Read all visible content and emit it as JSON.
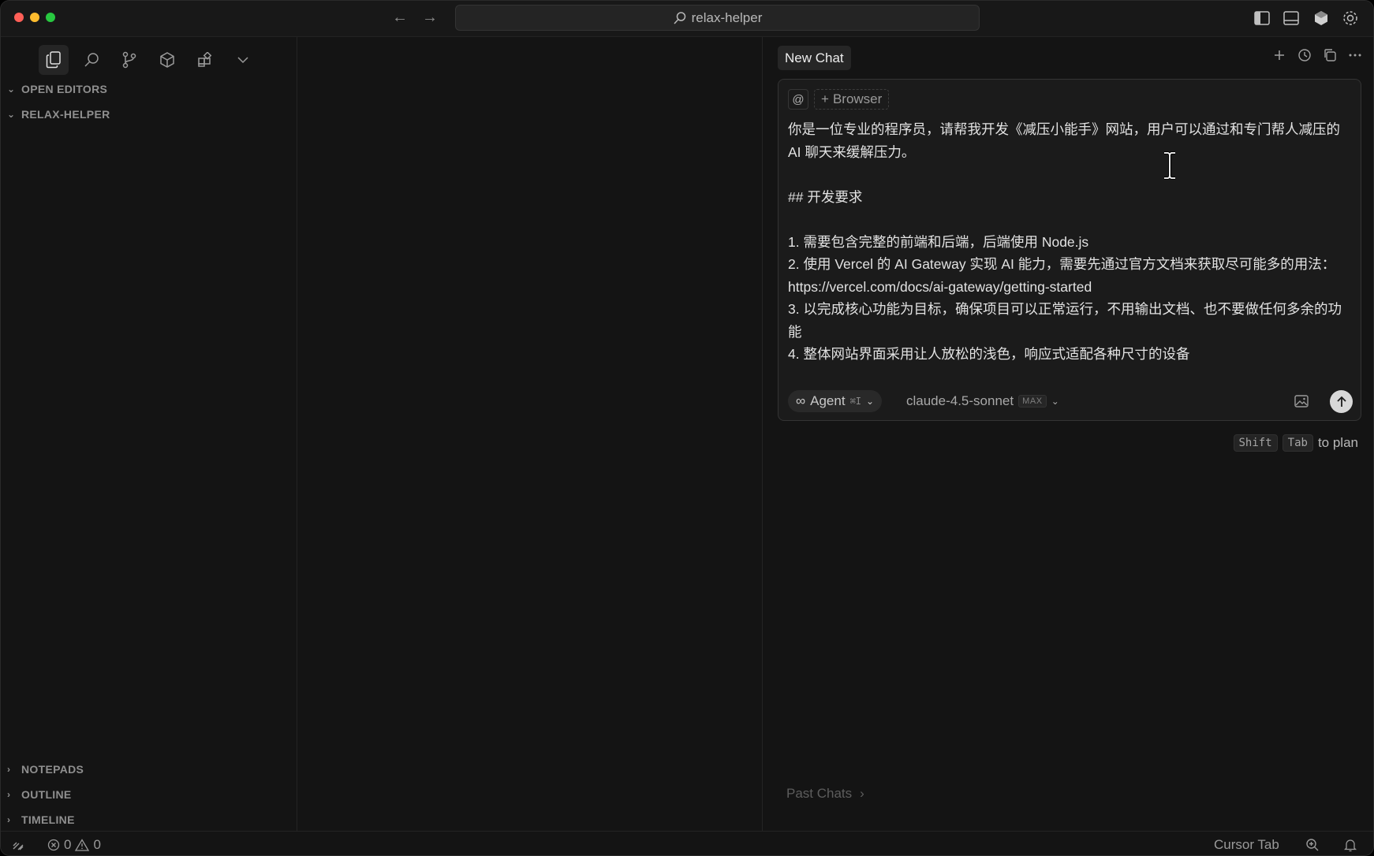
{
  "titlebar": {
    "search_text": "relax-helper"
  },
  "sidebar": {
    "sections_top": [
      {
        "label": "OPEN EDITORS",
        "expanded": true
      },
      {
        "label": "RELAX-HELPER",
        "expanded": true
      }
    ],
    "sections_bottom": [
      {
        "label": "NOTEPADS",
        "expanded": false
      },
      {
        "label": "OUTLINE",
        "expanded": false
      },
      {
        "label": "TIMELINE",
        "expanded": false
      }
    ]
  },
  "chat": {
    "tab_label": "New Chat",
    "context": {
      "at_label": "@",
      "browser_label": "Browser"
    },
    "prompt_lines": [
      "你是一位专业的程序员，请帮我开发《减压小能手》网站，用户可以通过和专门帮人减压的 AI 聊天来缓解压力。",
      "",
      "## 开发要求",
      "",
      "1. 需要包含完整的前端和后端，后端使用 Node.js",
      "2. 使用 Vercel 的 AI Gateway 实现 AI 能力，需要先通过官方文档来获取尽可能多的用法：https://vercel.com/docs/ai-gateway/getting-started",
      "3. 以完成核心功能为目标，确保项目可以正常运行，不用输出文档、也不要做任何多余的功能",
      "4. 整体网站界面采用让人放松的浅色，响应式适配各种尺寸的设备"
    ],
    "agent_label": "Agent",
    "agent_shortcut": "⌘I",
    "model_name": "claude-4.5-sonnet",
    "model_badge": "MAX",
    "hint": {
      "key1": "Shift",
      "key2": "Tab",
      "text": "to plan"
    },
    "past_chats_label": "Past Chats"
  },
  "statusbar": {
    "errors": "0",
    "warnings": "0",
    "cursor_tab_label": "Cursor Tab"
  }
}
